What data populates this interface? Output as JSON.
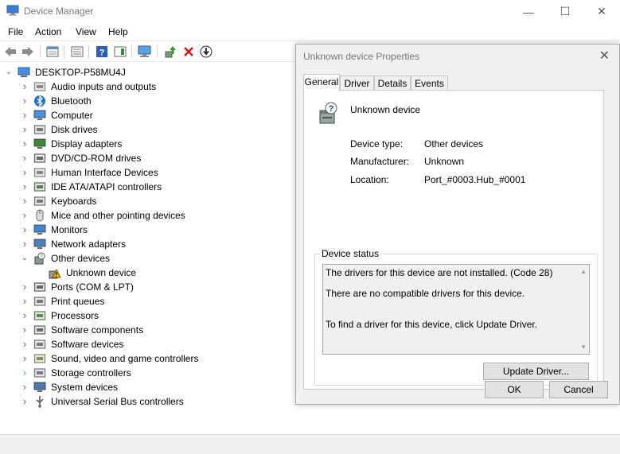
{
  "window": {
    "title": "Device Manager",
    "minimize": "—",
    "maximize": "☐",
    "close": "✕"
  },
  "menu": [
    "File",
    "Action",
    "View",
    "Help"
  ],
  "tree": {
    "root": "DESKTOP-P58MU4J",
    "items": [
      {
        "label": "Audio inputs and outputs",
        "icon": "speaker-icon"
      },
      {
        "label": "Bluetooth",
        "icon": "bluetooth-icon"
      },
      {
        "label": "Computer",
        "icon": "computer-icon"
      },
      {
        "label": "Disk drives",
        "icon": "disk-icon"
      },
      {
        "label": "Display adapters",
        "icon": "display-adapter-icon"
      },
      {
        "label": "DVD/CD-ROM drives",
        "icon": "dvd-icon"
      },
      {
        "label": "Human Interface Devices",
        "icon": "hid-icon"
      },
      {
        "label": "IDE ATA/ATAPI controllers",
        "icon": "ide-icon"
      },
      {
        "label": "Keyboards",
        "icon": "keyboard-icon"
      },
      {
        "label": "Mice and other pointing devices",
        "icon": "mouse-icon"
      },
      {
        "label": "Monitors",
        "icon": "monitor-icon"
      },
      {
        "label": "Network adapters",
        "icon": "network-icon"
      },
      {
        "label": "Other devices",
        "icon": "other-devices-icon",
        "expanded": true
      },
      {
        "label": "Unknown device",
        "icon": "unknown-device-warning-icon",
        "child": true
      },
      {
        "label": "Ports (COM & LPT)",
        "icon": "port-icon"
      },
      {
        "label": "Print queues",
        "icon": "printer-icon"
      },
      {
        "label": "Processors",
        "icon": "processor-icon"
      },
      {
        "label": "Software components",
        "icon": "software-component-icon"
      },
      {
        "label": "Software devices",
        "icon": "software-device-icon"
      },
      {
        "label": "Sound, video and game controllers",
        "icon": "sound-icon"
      },
      {
        "label": "Storage controllers",
        "icon": "storage-icon"
      },
      {
        "label": "System devices",
        "icon": "system-icon"
      },
      {
        "label": "Universal Serial Bus controllers",
        "icon": "usb-icon"
      }
    ]
  },
  "dialog": {
    "title": "Unknown device Properties",
    "tabs": [
      "General",
      "Driver",
      "Details",
      "Events"
    ],
    "device_name": "Unknown device",
    "props": [
      {
        "key": "Device type:",
        "value": "Other devices"
      },
      {
        "key": "Manufacturer:",
        "value": "Unknown"
      },
      {
        "key": "Location:",
        "value": "Port_#0003.Hub_#0001"
      }
    ],
    "status_title": "Device status",
    "status_lines": [
      "The drivers for this device are not installed. (Code 28)",
      "There are no compatible drivers for this device.",
      "To find a driver for this device, click Update Driver."
    ],
    "update_button": "Update Driver...",
    "ok_button": "OK",
    "cancel_button": "Cancel"
  }
}
